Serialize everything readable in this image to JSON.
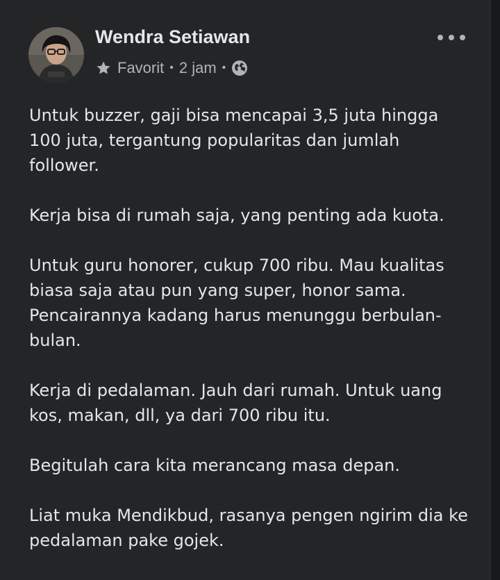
{
  "post": {
    "author": "Wendra Setiawan",
    "audience_label": "Favorit",
    "timestamp": "2 jam",
    "separator": "•",
    "privacy_icon": "globe-icon",
    "audience_icon": "star-icon",
    "options_icon": "more-options-icon",
    "paragraphs": [
      "Untuk buzzer, gaji bisa mencapai 3,5 juta hingga 100 juta, tergantung popularitas dan jumlah follower.",
      "Kerja bisa di rumah saja, yang penting ada kuota.",
      "Untuk guru honorer, cukup 700 ribu. Mau kualitas biasa saja atau pun yang super, honor sama. Pencairannya kadang harus menunggu berbulan-bulan.",
      "Kerja di pedalaman. Jauh dari rumah. Untuk uang kos, makan, dll, ya dari 700 ribu itu.",
      "Begitulah cara kita merancang masa depan.",
      "Liat muka Mendikbud, rasanya pengen ngirim dia ke pedalaman pake gojek."
    ]
  },
  "colors": {
    "background": "#242526",
    "text_primary": "#e4e6eb",
    "text_secondary": "#b0b3b8"
  }
}
